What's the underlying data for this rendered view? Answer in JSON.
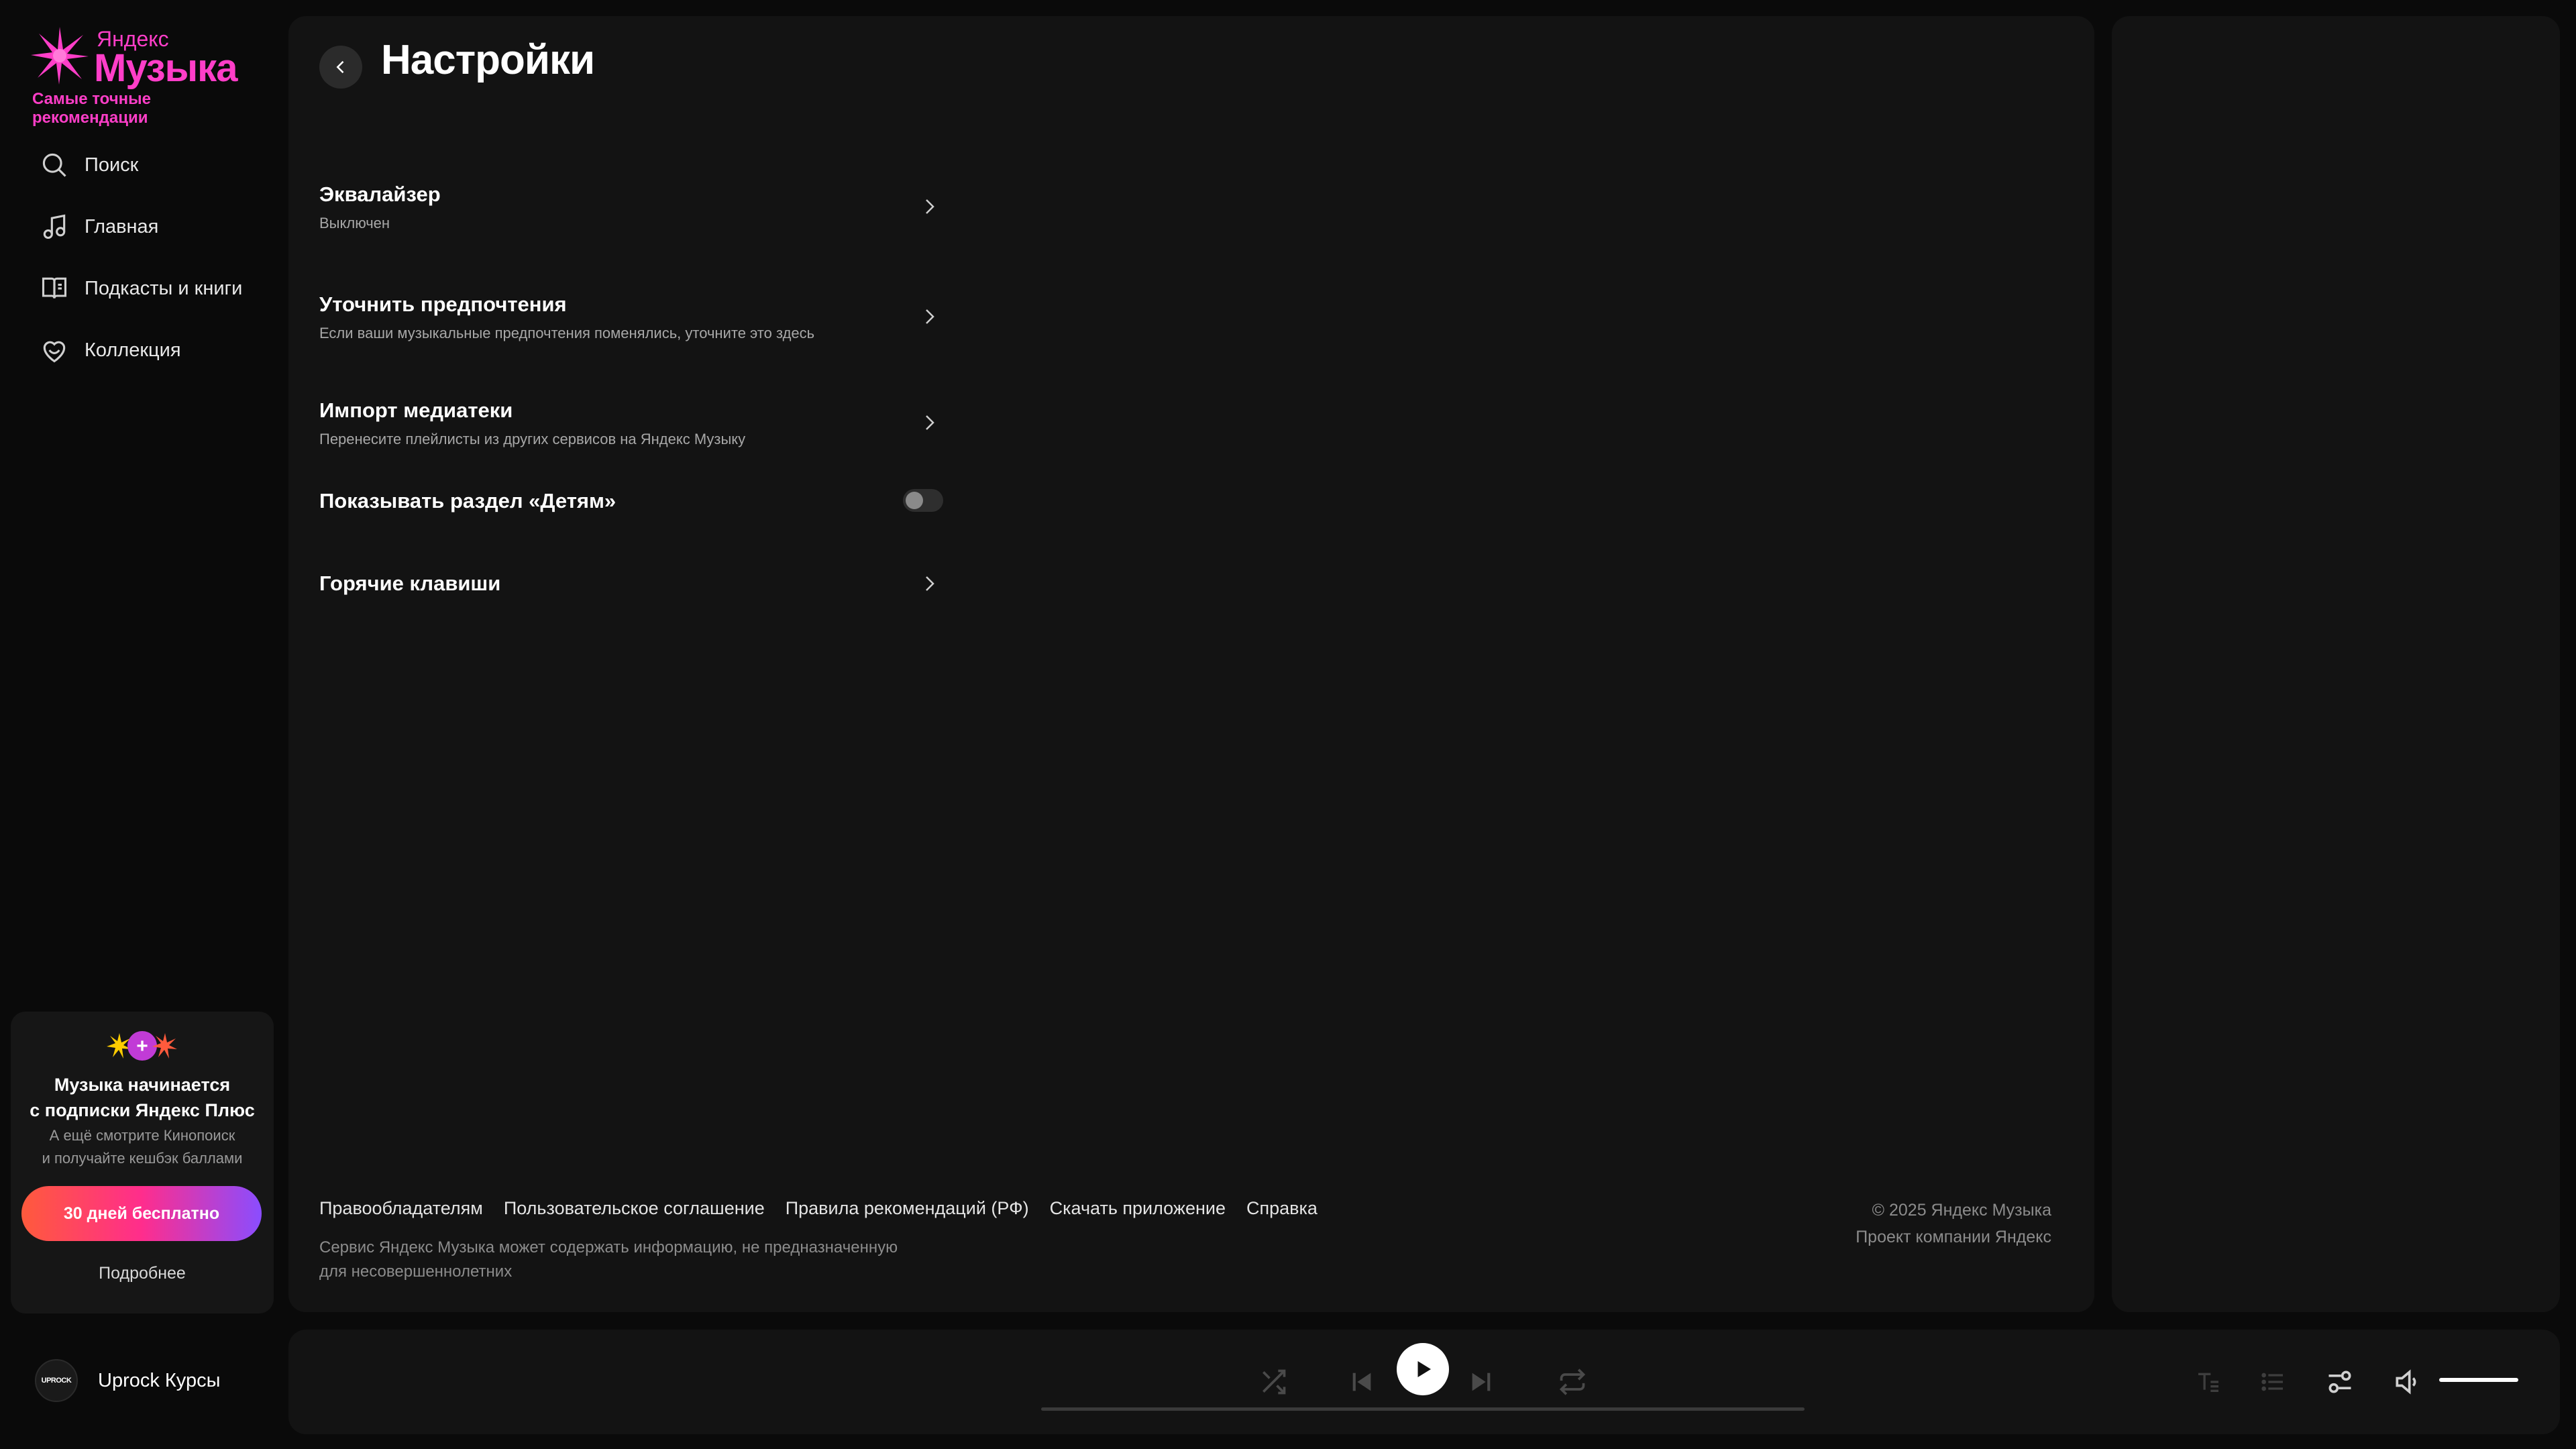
{
  "brand": {
    "small": "Яндекс",
    "big": "Музыка",
    "tagline": "Самые точные рекомендации",
    "accent_color": "#ff3ec8"
  },
  "nav": {
    "items": [
      {
        "label": "Поиск",
        "icon": "search-icon"
      },
      {
        "label": "Главная",
        "icon": "music-note-icon"
      },
      {
        "label": "Подкасты и книги",
        "icon": "book-icon"
      },
      {
        "label": "Коллекция",
        "icon": "heart-icon"
      }
    ]
  },
  "promo": {
    "title_line1": "Музыка начинается",
    "title_line2": "с подписки Яндекс Плюс",
    "text_line1": "А ещё смотрите Кинопоиск",
    "text_line2": "и получайте кешбэк баллами",
    "button_label": "30 дней бесплатно",
    "more_label": "Подробнее"
  },
  "page": {
    "title": "Настройки"
  },
  "settings": [
    {
      "title": "Эквалайзер",
      "description": "Выключен",
      "control": "chevron"
    },
    {
      "title": "Уточнить предпочтения",
      "description": "Если ваши музыкальные предпочтения поменялись, уточните это здесь",
      "control": "chevron"
    },
    {
      "title": "Импорт медиатеки",
      "description": "Перенесите плейлисты из других сервисов на Яндекс Музыку",
      "control": "chevron"
    },
    {
      "title": "Показывать раздел «Детям»",
      "description": "",
      "control": "toggle",
      "enabled": false
    },
    {
      "title": "Горячие клавиши",
      "description": "",
      "control": "chevron"
    }
  ],
  "footer": {
    "links": [
      "Правообладателям",
      "Пользовательское соглашение",
      "Правила рекомендаций (РФ)",
      "Скачать приложение",
      "Справка"
    ],
    "note_line1": "Сервис Яндекс Музыка может содержать информацию, не предназначенную",
    "note_line2": "для несовершеннолетних",
    "copyright_line1": "© 2025  Яндекс Музыка",
    "copyright_line2": "Проект компании Яндекс"
  },
  "user": {
    "avatar_text": "UPROCK",
    "name": "Uprock Курсы"
  },
  "player": {
    "controls": [
      "shuffle-icon",
      "previous-icon",
      "play-icon",
      "next-icon",
      "repeat-icon"
    ],
    "right_controls": [
      "lyrics-icon",
      "queue-icon",
      "equalizer-icon",
      "volume-icon"
    ],
    "volume_fraction": 1.0
  }
}
